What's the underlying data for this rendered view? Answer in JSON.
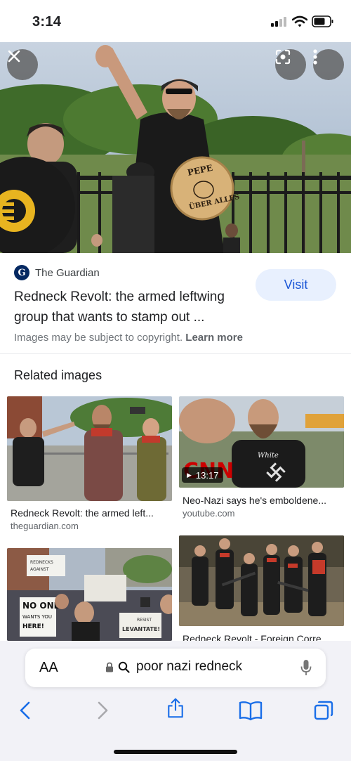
{
  "status_bar": {
    "time": "3:14"
  },
  "image_viewer": {
    "source": {
      "name": "The Guardian",
      "logo_letter": "G"
    },
    "title": "Redneck Revolt: the armed leftwing group that wants to stamp out ...",
    "visit_label": "Visit",
    "copyright_text": "Images may be subject to copyright.",
    "learn_more_label": "Learn more",
    "hero_overlay": {
      "shield_text_top": "PEPE",
      "shield_text_bottom": "ÜBER ALLES"
    }
  },
  "related": {
    "heading": "Related images",
    "items": [
      {
        "caption": "Redneck Revolt: the armed left...",
        "source": "theguardian.com"
      },
      {
        "caption": "Neo-Nazi says he's emboldene...",
        "source": "youtube.com",
        "duration": "13:17",
        "overlay_text": "CNN",
        "shirt_text": "White"
      },
      {
        "caption": "",
        "source": "",
        "sign_texts": [
          "NO ONE",
          "WANTS YOU",
          "HERE!",
          "RESIST",
          "LEVANTATE!"
        ]
      },
      {
        "caption": "Redneck Revolt - Foreign Corre...",
        "source": ""
      }
    ]
  },
  "browser": {
    "text_size_label": "AA",
    "search_query": "poor nazi redneck"
  },
  "colors": {
    "accent": "#1a56d6",
    "visit_bg": "#e8f0fe",
    "cnn_red": "#cc0000"
  },
  "icons": [
    "close-icon",
    "lens-icon",
    "more-icon",
    "back-icon",
    "forward-icon",
    "share-icon",
    "bookmarks-icon",
    "tabs-icon",
    "lock-icon",
    "search-icon",
    "mic-icon"
  ]
}
